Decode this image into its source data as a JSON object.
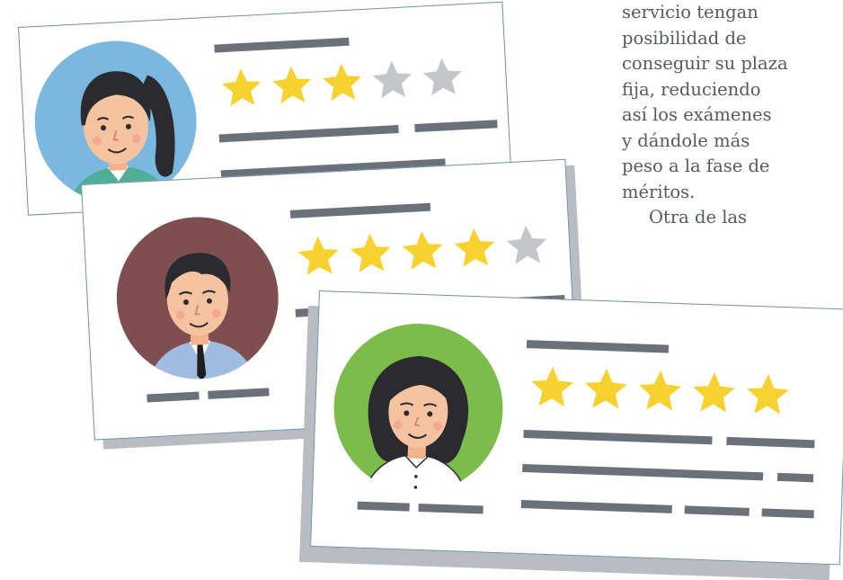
{
  "article": {
    "lines": [
      "servicio tengan",
      "posibilidad de",
      "conseguir su plaza",
      "fija, reduciendo",
      "así los exámenes",
      "y dándole más",
      "peso a la fase de",
      "méritos.",
      "Otra de las"
    ]
  },
  "cards": [
    {
      "person": "woman-ponytail",
      "avatar_bg": "#7ab8e0",
      "rating": 3,
      "max": 5
    },
    {
      "person": "man-suit",
      "avatar_bg": "#7f4e51",
      "rating": 4,
      "max": 5
    },
    {
      "person": "woman-long-hair",
      "avatar_bg": "#7cbc4a",
      "rating": 5,
      "max": 5
    }
  ],
  "colors": {
    "star_filled": "#f6d130",
    "star_empty": "#c4c6c9",
    "text_lines": "#6b717a",
    "card_border": "#6e8fab"
  }
}
